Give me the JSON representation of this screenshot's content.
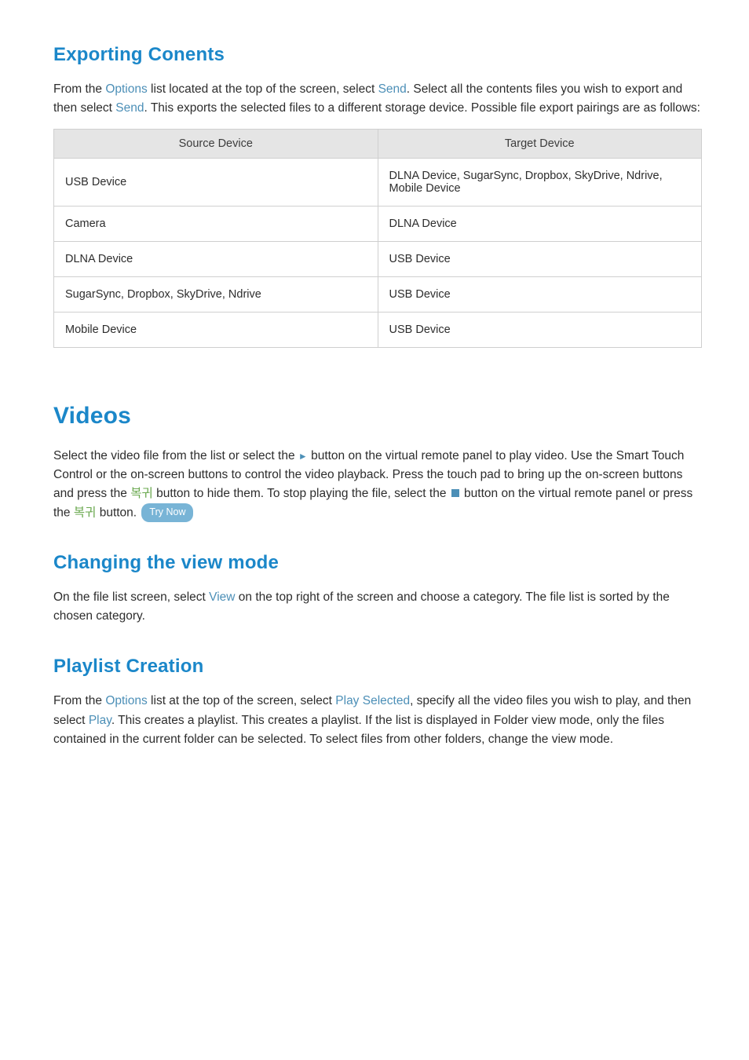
{
  "exporting": {
    "heading": "Exporting Conents",
    "p1_a": "From the ",
    "p1_options": "Options",
    "p1_b": " list located at the top of the screen, select ",
    "p1_send1": "Send",
    "p1_c": ". Select all the contents files you wish to export and then select ",
    "p1_send2": "Send",
    "p1_d": ". This exports the selected files to a different storage device. Possible file export pairings are as follows:",
    "table": {
      "headers": {
        "source": "Source Device",
        "target": "Target Device"
      },
      "rows": [
        {
          "source": "USB Device",
          "target": "DLNA Device, SugarSync, Dropbox, SkyDrive, Ndrive, Mobile Device"
        },
        {
          "source": "Camera",
          "target": "DLNA Device"
        },
        {
          "source": "DLNA Device",
          "target": "USB Device"
        },
        {
          "source": "SugarSync, Dropbox, SkyDrive, Ndrive",
          "target": "USB Device"
        },
        {
          "source": "Mobile Device",
          "target": "USB Device"
        }
      ]
    }
  },
  "videos": {
    "heading": "Videos",
    "p1_a": "Select the video file from the list or select the ",
    "p1_play": "∥",
    "p1_b": " button on the virtual remote panel to play video. Use the Smart Touch Control or the on-screen buttons to control the video playback. Press the touch pad to bring up the on-screen buttons and press the ",
    "p1_korean1": "복귀",
    "p1_c": " button to hide them. To stop playing the file, select the ",
    "p1_d": " button on the virtual remote panel or press the ",
    "p1_korean2": "복귀",
    "p1_e": " button. ",
    "try_now": "Try Now"
  },
  "viewmode": {
    "heading": "Changing the view mode",
    "p1_a": "On the file list screen, select ",
    "p1_view": "View",
    "p1_b": " on the top right of the screen and choose a category. The file list is sorted by the chosen category."
  },
  "playlist": {
    "heading": "Playlist Creation",
    "p1_a": "From the ",
    "p1_options": "Options",
    "p1_b": " list at the top of the screen, select ",
    "p1_playselected": "Play Selected",
    "p1_c": ", specify all the video files you wish to play, and then select ",
    "p1_play": "Play",
    "p1_d": ". This creates a playlist. This creates a playlist. If the list is displayed in Folder view mode, only the files contained in the current folder can be selected. To select files from other folders, change the view mode."
  }
}
